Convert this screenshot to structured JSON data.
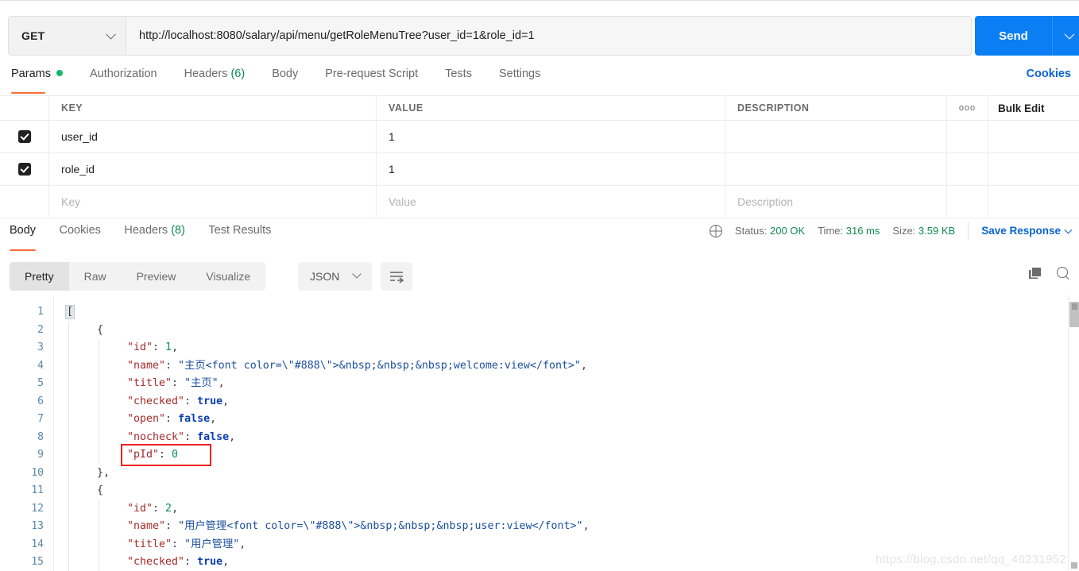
{
  "request": {
    "method": "GET",
    "url": "http://localhost:8080/salary/api/menu/getRoleMenuTree?user_id=1&role_id=1",
    "send_label": "Send"
  },
  "request_tabs": [
    {
      "label": "Params",
      "badge": "dot"
    },
    {
      "label": "Authorization"
    },
    {
      "label": "Headers",
      "count": "(6)"
    },
    {
      "label": "Body"
    },
    {
      "label": "Pre-request Script"
    },
    {
      "label": "Tests"
    },
    {
      "label": "Settings"
    }
  ],
  "cookies_link": "Cookies",
  "params_table": {
    "headers": {
      "key": "KEY",
      "value": "VALUE",
      "description": "DESCRIPTION",
      "dots": "ooo",
      "bulk_edit": "Bulk Edit"
    },
    "rows": [
      {
        "checked": true,
        "key": "user_id",
        "value": "1",
        "description": ""
      },
      {
        "checked": true,
        "key": "role_id",
        "value": "1",
        "description": ""
      }
    ],
    "placeholder_row": {
      "key": "Key",
      "value": "Value",
      "description": "Description"
    }
  },
  "response_tabs": [
    {
      "label": "Body"
    },
    {
      "label": "Cookies"
    },
    {
      "label": "Headers",
      "count": "(8)"
    },
    {
      "label": "Test Results"
    }
  ],
  "response_status": {
    "status_label": "Status:",
    "status_value": "200 OK",
    "time_label": "Time:",
    "time_value": "316 ms",
    "size_label": "Size:",
    "size_value": "3.59 KB",
    "save_response": "Save Response"
  },
  "format_bar": {
    "segments": [
      "Pretty",
      "Raw",
      "Preview",
      "Visualize"
    ],
    "active_segment": "Pretty",
    "language": "JSON"
  },
  "code": {
    "line_numbers": [
      "1",
      "2",
      "3",
      "4",
      "5",
      "6",
      "7",
      "8",
      "9",
      "10",
      "11",
      "12",
      "13",
      "14",
      "15"
    ],
    "lines": [
      {
        "n": 1,
        "indent": 0,
        "tokens": [
          {
            "t": "[",
            "c": "br"
          }
        ]
      },
      {
        "n": 2,
        "indent": 1,
        "tokens": [
          {
            "t": "{",
            "c": "br"
          }
        ]
      },
      {
        "n": 3,
        "indent": 2,
        "tokens": [
          {
            "t": "\"id\"",
            "c": "k"
          },
          {
            "t": ": ",
            "c": "p"
          },
          {
            "t": "1",
            "c": "n"
          },
          {
            "t": ",",
            "c": "p"
          }
        ]
      },
      {
        "n": 4,
        "indent": 2,
        "tokens": [
          {
            "t": "\"name\"",
            "c": "k"
          },
          {
            "t": ": ",
            "c": "p"
          },
          {
            "t": "\"主页<font color=\\\"#888\\\">&nbsp;&nbsp;&nbsp;welcome:view</font>\"",
            "c": "s"
          },
          {
            "t": ",",
            "c": "p"
          }
        ]
      },
      {
        "n": 5,
        "indent": 2,
        "tokens": [
          {
            "t": "\"title\"",
            "c": "k"
          },
          {
            "t": ": ",
            "c": "p"
          },
          {
            "t": "\"主页\"",
            "c": "s"
          },
          {
            "t": ",",
            "c": "p"
          }
        ]
      },
      {
        "n": 6,
        "indent": 2,
        "tokens": [
          {
            "t": "\"checked\"",
            "c": "k"
          },
          {
            "t": ": ",
            "c": "p"
          },
          {
            "t": "true",
            "c": "b"
          },
          {
            "t": ",",
            "c": "p"
          }
        ]
      },
      {
        "n": 7,
        "indent": 2,
        "tokens": [
          {
            "t": "\"open\"",
            "c": "k"
          },
          {
            "t": ": ",
            "c": "p"
          },
          {
            "t": "false",
            "c": "b"
          },
          {
            "t": ",",
            "c": "p"
          }
        ]
      },
      {
        "n": 8,
        "indent": 2,
        "tokens": [
          {
            "t": "\"nocheck\"",
            "c": "k"
          },
          {
            "t": ": ",
            "c": "p"
          },
          {
            "t": "false",
            "c": "b"
          },
          {
            "t": ",",
            "c": "p"
          }
        ]
      },
      {
        "n": 9,
        "indent": 2,
        "tokens": [
          {
            "t": "\"pId\"",
            "c": "k"
          },
          {
            "t": ": ",
            "c": "p"
          },
          {
            "t": "0",
            "c": "n"
          }
        ]
      },
      {
        "n": 10,
        "indent": 1,
        "tokens": [
          {
            "t": "}",
            "c": "br"
          },
          {
            "t": ",",
            "c": "p"
          }
        ]
      },
      {
        "n": 11,
        "indent": 1,
        "tokens": [
          {
            "t": "{",
            "c": "br"
          }
        ]
      },
      {
        "n": 12,
        "indent": 2,
        "tokens": [
          {
            "t": "\"id\"",
            "c": "k"
          },
          {
            "t": ": ",
            "c": "p"
          },
          {
            "t": "2",
            "c": "n"
          },
          {
            "t": ",",
            "c": "p"
          }
        ]
      },
      {
        "n": 13,
        "indent": 2,
        "tokens": [
          {
            "t": "\"name\"",
            "c": "k"
          },
          {
            "t": ": ",
            "c": "p"
          },
          {
            "t": "\"用户管理<font color=\\\"#888\\\">&nbsp;&nbsp;&nbsp;user:view</font>\"",
            "c": "s"
          },
          {
            "t": ",",
            "c": "p"
          }
        ]
      },
      {
        "n": 14,
        "indent": 2,
        "tokens": [
          {
            "t": "\"title\"",
            "c": "k"
          },
          {
            "t": ": ",
            "c": "p"
          },
          {
            "t": "\"用户管理\"",
            "c": "s"
          },
          {
            "t": ",",
            "c": "p"
          }
        ]
      },
      {
        "n": 15,
        "indent": 2,
        "tokens": [
          {
            "t": "\"checked\"",
            "c": "k"
          },
          {
            "t": ": ",
            "c": "p"
          },
          {
            "t": "true",
            "c": "b"
          },
          {
            "t": ",",
            "c": "p"
          }
        ]
      }
    ],
    "annotation": {
      "shape": "rectangle",
      "color": "#ee2222",
      "targets_line": 9,
      "targets_text": "\"pId\": 0"
    }
  },
  "watermark": "https://blog.csdn.net/qq_46231952"
}
